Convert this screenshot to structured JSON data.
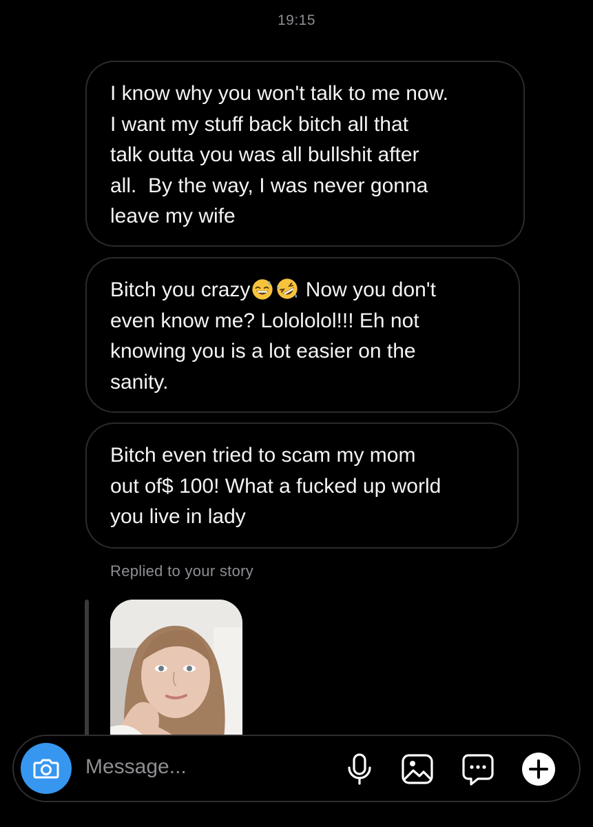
{
  "thread": {
    "timestamp": "19:15",
    "messages": [
      {
        "lines": [
          "I know why you won't talk to me now.",
          "I want my stuff back bitch all that",
          "talk outta you was all bullshit after",
          "all.  By the way, I was never gonna",
          "leave my wife"
        ]
      },
      {
        "line1_before_emoji": "Bitch you crazy",
        "emojis": [
          "grinning-sweat-emoji",
          "rofl-emoji"
        ],
        "line1_after_emoji": " Now you don't",
        "lines_rest": [
          "even know me? Lolololol!!! Eh not",
          "knowing you is a lot easier on the",
          "sanity."
        ]
      },
      {
        "lines": [
          "Bitch even tried to scam my mom",
          "out of$ 100! What a fucked up world",
          "you live in lady"
        ]
      }
    ],
    "story_reply": {
      "note": "Replied to your story"
    }
  },
  "composer": {
    "placeholder": "Message...",
    "icons": {
      "camera": "camera-icon",
      "mic": "microphone-icon",
      "gallery": "image-icon",
      "sticker": "sticker-icon",
      "plus": "plus-icon"
    },
    "accent_color": "#3797f0"
  }
}
